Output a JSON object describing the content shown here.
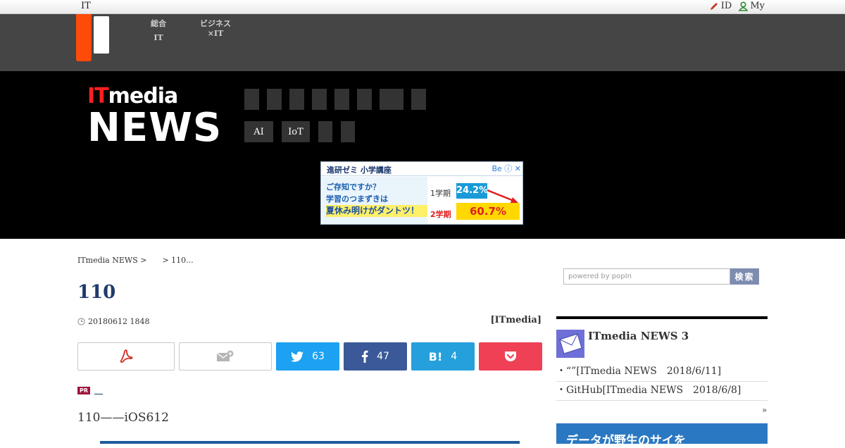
{
  "topbar": {
    "brand": "IT",
    "links": [
      {
        "label": "ID",
        "icon": "pencil-icon"
      },
      {
        "label": "My",
        "icon": "user-icon"
      }
    ]
  },
  "netnav": [
    {
      "line1": "総合",
      "line2": "IT"
    },
    {
      "line1": "ビジネス",
      "line2": "×IT"
    }
  ],
  "logo": {
    "top": "ITmedia",
    "bottom": "NEWS"
  },
  "categories": {
    "row1": [
      "",
      "",
      "",
      "",
      "",
      "",
      "",
      ""
    ],
    "row2": [
      "AI",
      "IoT",
      "",
      ""
    ]
  },
  "ad": {
    "header": "進研ゼミ 小学講座",
    "lines": [
      "ご存知ですか？",
      "学習のつまずきは",
      "夏休み明けがダントツ！"
    ],
    "term1_label": "1学期",
    "term1_value": "24.2%",
    "term2_label": "2学期",
    "term2_value": "60.7%",
    "brand_mark": "Be"
  },
  "article": {
    "breadcrumb": "ITmedia NEWS >　　> 110...",
    "title": "110",
    "date": "20180612 1848",
    "author": "[ITmedia]",
    "pr_badge": "PR",
    "lead": "110——iOS612"
  },
  "share": {
    "twitter_count": "63",
    "facebook_count": "47",
    "hatena_label": "B!",
    "hatena_count": "4"
  },
  "sidebar": {
    "search_placeholder": "powered by popIn",
    "search_button": "検索",
    "newsletter_title": "ITmedia NEWS 3",
    "links": [
      "・“”[ITmedia NEWS　2018/6/11]",
      "・GitHub[ITmedia NEWS　2018/6/8]"
    ],
    "more": "»",
    "ad_text": "データが野生のサイを"
  },
  "colors": {
    "twitter": "#1da1f2",
    "facebook": "#3b5998",
    "hatena": "#25a0dc",
    "pocket": "#ef4056",
    "accent": "#ff4a0a"
  }
}
